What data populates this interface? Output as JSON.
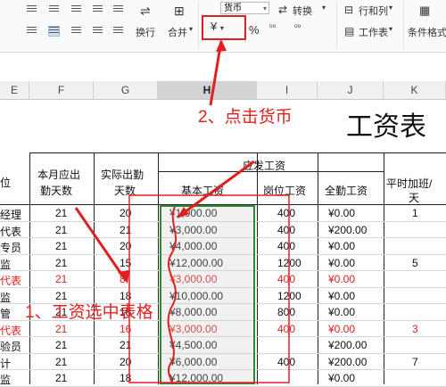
{
  "ribbon": {
    "num_format_value": "货币",
    "convert_label": "转换",
    "rows_cols_label": "行和列",
    "wrap_label": "换行",
    "merge_label": "合并",
    "worksheet_label": "工作表",
    "cond_format_label": "条件格式",
    "currency_symbol": "¥",
    "percent_symbol": "%",
    "dec_increase_label": "⁰⁰",
    "dec_decrease_label": "⁰⁰"
  },
  "columns": [
    "E",
    "F",
    "G",
    "H",
    "I",
    "J",
    "K"
  ],
  "selected_column": "H",
  "sheet": {
    "title": "工资表",
    "header_group": "应发工资",
    "headers": {
      "position": "位",
      "days_due_1": "本月应出",
      "days_due_2": "勤天数",
      "days_actual_1": "实际出勤",
      "days_actual_2": "天数",
      "base_salary": "基本工资",
      "post_salary": "岗位工资",
      "attendance": "全勤工资",
      "overtime_1": "平时加班/",
      "overtime_2": "天"
    },
    "rows": [
      {
        "pos": "经理",
        "due": "21",
        "actual": "20",
        "base": "¥1,000.00",
        "post": "400",
        "full": "¥0.00",
        "ot": "1",
        "red": false
      },
      {
        "pos": "代表",
        "due": "21",
        "actual": "21",
        "base": "¥3,000.00",
        "post": "400",
        "full": "¥200.00",
        "ot": "",
        "red": false
      },
      {
        "pos": "专员",
        "due": "21",
        "actual": "20",
        "base": "¥4,000.00",
        "post": "400",
        "full": "¥0.00",
        "ot": "",
        "red": false
      },
      {
        "pos": "监",
        "due": "21",
        "actual": "15",
        "base": "¥12,000.00",
        "post": "1200",
        "full": "¥0.00",
        "ot": "5",
        "red": false
      },
      {
        "pos": "代表",
        "due": "21",
        "actual": "8",
        "base": "¥3,000.00",
        "post": "400",
        "full": "¥0.00",
        "ot": "",
        "red": true
      },
      {
        "pos": "监",
        "due": "21",
        "actual": "18",
        "base": "¥10,000.00",
        "post": "1200",
        "full": "¥0.00",
        "ot": "",
        "red": false
      },
      {
        "pos": "管",
        "due": "21",
        "actual": "18",
        "base": "¥8,000.00",
        "post": "800",
        "full": "¥0.00",
        "ot": "",
        "red": false
      },
      {
        "pos": "代表",
        "due": "21",
        "actual": "16",
        "base": "¥3,000.00",
        "post": "400",
        "full": "¥0.00",
        "ot": "3",
        "red": true
      },
      {
        "pos": "验员",
        "due": "21",
        "actual": "21",
        "base": "¥4,500.00",
        "post": "",
        "full": "¥200.00",
        "ot": "",
        "red": false
      },
      {
        "pos": "计",
        "due": "21",
        "actual": "20",
        "base": "¥6,000.00",
        "post": "400",
        "full": "¥200.00",
        "ot": "7",
        "red": false
      },
      {
        "pos": "监",
        "due": "21",
        "actual": "18",
        "base": "¥12,000.00",
        "post": "",
        "full": "¥0.00",
        "ot": "",
        "red": false
      }
    ]
  },
  "annotations": {
    "step1": "1、工资选中表格",
    "step2": "2、点击货币"
  },
  "colors": {
    "accent_red": "#e02020",
    "select_green": "#2e8b2e"
  }
}
